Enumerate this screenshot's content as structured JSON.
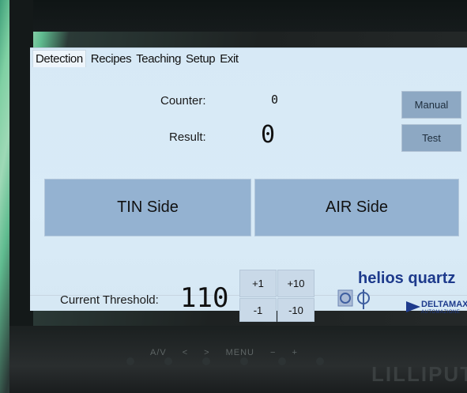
{
  "menu": [
    "Detection",
    "Recipes",
    "Teaching",
    "Setup",
    "Exit"
  ],
  "counter": {
    "label": "Counter:",
    "value": "0"
  },
  "result": {
    "label": "Result:",
    "value": "0"
  },
  "buttons": {
    "manual": "Manual",
    "test": "Test",
    "tin": "TIN Side",
    "air": "AIR Side"
  },
  "threshold": {
    "label": "Current Threshold:",
    "value": "110"
  },
  "steps": {
    "p1": "+1",
    "p10": "+10",
    "m1": "-1",
    "m10": "-10"
  },
  "logos": {
    "helios": "helios quartz",
    "deltamax": "DELTAMAX",
    "deltamax_sub": "AUTOMAZIONE"
  },
  "bezel": {
    "labels": [
      "A/V",
      "<",
      ">",
      "MENU",
      "−",
      "+"
    ],
    "brand": "LILLIPUT"
  },
  "colors": {
    "screen_bg": "#d7e9f6",
    "side_button": "#94b2d1",
    "accent_blue": "#1d3a8c"
  }
}
